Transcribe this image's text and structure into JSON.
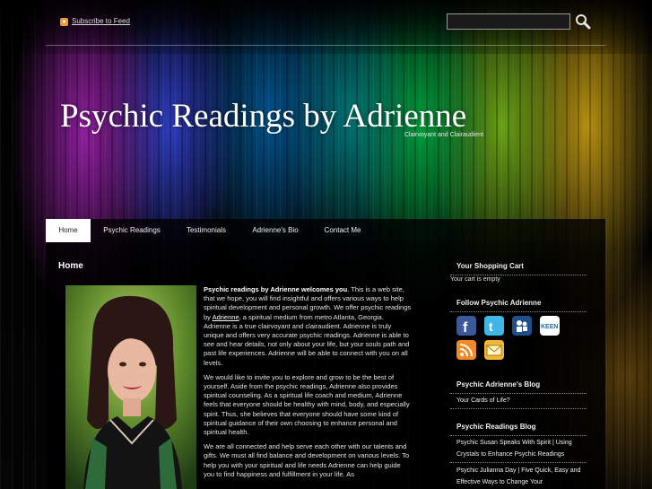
{
  "topbar": {
    "rss_label": "Subscribe to Feed",
    "search_placeholder": ""
  },
  "header": {
    "title": "Psychic Readings by Adrienne",
    "tagline": "Clairvoyant and Clairaudient"
  },
  "nav": {
    "items": [
      {
        "label": "Home",
        "active": true
      },
      {
        "label": "Psychic Readings"
      },
      {
        "label": "Testimonials"
      },
      {
        "label": "Adrienne's Bio"
      },
      {
        "label": "Contact Me"
      }
    ]
  },
  "main": {
    "heading": "Home",
    "intro_bold": "Psychic readings by Adrienne welcomes you",
    "intro_rest": ". This is a web site, that we hope, you will find insightful and offers various ways to help spiritual development and personal growth. We offer psychic readings by ",
    "intro_link": "Adrienne",
    "intro_end": ", a spiritual medium from metro Atlanta, Georgia. Adrienne is a true clairvoyant and clairaudient. Adrienne is truly unique and offers very accurate psychic readings. Adrienne is able to see and hear details, not only about your life, but your souls path and past life experiences. Adrienne will be able to connect with you on all levels.",
    "para2": "We would like to invite you to explore and grow to be the best of yourself. Aside from the psychic readings, Adrienne also provides spiritual counseling. As a spiritual life coach and medium, Adrienne feels that everyone should be healthy with mind, body, and especially spirit. Thus, she believes that everyone should have some kind of spiritual guidance of their own choosing to enhance personal and spiritual health.",
    "para3": "We are all connected and help serve each other with our talents and gifts. We must all find balance and development on various levels. To help you with your spiritual and life needs Adrienne can help guide you to find happiness and fulfillment in your life. As"
  },
  "sidebar": {
    "cart_heading": "Your Shopping Cart",
    "cart_status": "Your cart is empty",
    "follow_heading": "Follow Psychic Adrienne",
    "social_icons": [
      "facebook-icon",
      "twitter-icon",
      "myspace-icon",
      "keen-icon",
      "rss-feed-icon",
      "email-icon"
    ],
    "blog1_heading": "Psychic Adrienne's Blog",
    "blog1_items": [
      "Your Cards of Life?"
    ],
    "blog2_heading": "Psychic Readings Blog",
    "blog2_items": [
      "Psychic Susan Speaks With Spirit | Using Crystals to Enhance Psychic Readings",
      "Psychic Julianna Day | Five Quick, Easy and Effective Ways to Change Your"
    ]
  },
  "colors": {
    "rss": "#f39a2a",
    "nav_active_bg": "#ffffff"
  }
}
